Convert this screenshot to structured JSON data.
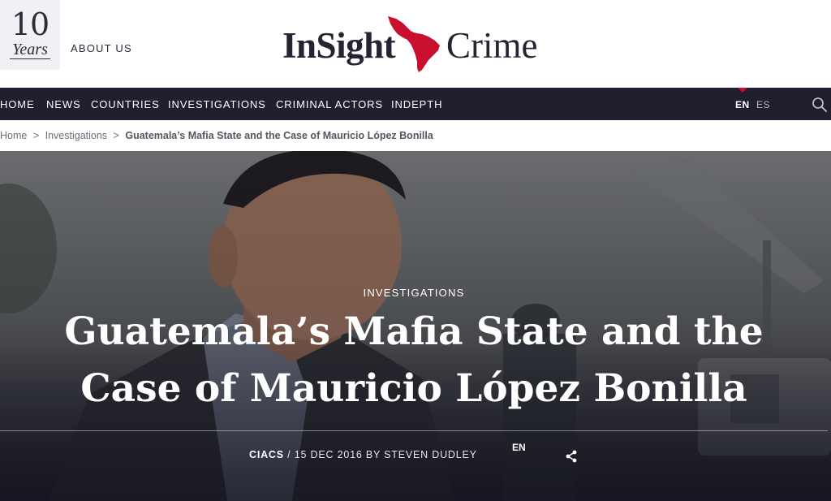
{
  "header": {
    "anniversary": {
      "number": "10",
      "label": "Years"
    },
    "about_label": "ABOUT US",
    "logo": {
      "word1": "InSight",
      "word2": "Crime"
    }
  },
  "nav": {
    "items": [
      {
        "label": "HOME"
      },
      {
        "label": "NEWS"
      },
      {
        "label": "COUNTRIES"
      },
      {
        "label": "INVESTIGATIONS"
      },
      {
        "label": "CRIMINAL ACTORS"
      },
      {
        "label": "INDEPTH"
      }
    ],
    "languages": [
      {
        "label": "EN",
        "active": true
      },
      {
        "label": "ES",
        "active": false
      }
    ],
    "search_icon": "search-icon"
  },
  "breadcrumb": {
    "items": [
      "Home",
      "Investigations"
    ],
    "separator": ">",
    "current": "Guatemala’s Mafia State and the Case of Mauricio López Bonilla"
  },
  "hero": {
    "category": "INVESTIGATIONS",
    "title": "Guatemala’s Mafia State and the Case of Mauricio López Bonilla",
    "byline": {
      "category": "CIACS",
      "rest": " / 15 DEC 2016 BY STEVEN DUDLEY"
    },
    "language": "EN",
    "share_icon": "share-icon"
  },
  "colors": {
    "nav_bg": "#1f1f2e",
    "brand_red": "#c8102e",
    "text_dark": "#242433"
  }
}
